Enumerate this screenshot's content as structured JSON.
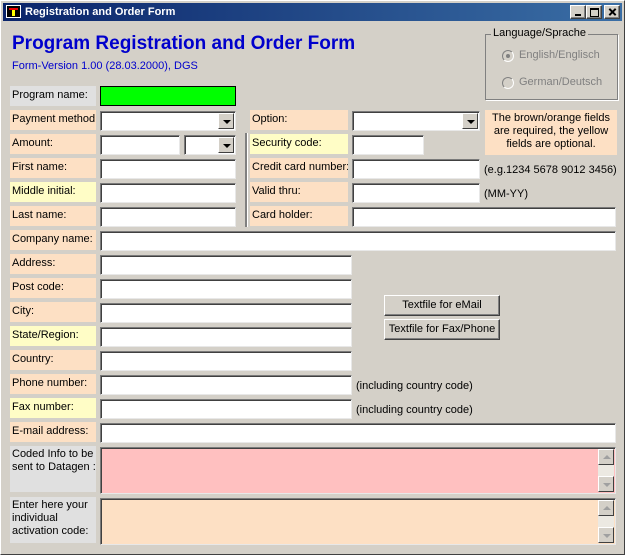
{
  "window": {
    "title": "Registration and Order Form",
    "minimize_icon": "minimize-icon",
    "maximize_icon": "maximize-icon",
    "close_icon": "close-icon"
  },
  "header": {
    "title": "Program Registration and Order Form",
    "version": "Form-Version 1.00 (28.03.2000), DGS"
  },
  "language": {
    "group_label": "Language/Sprache",
    "options": [
      {
        "label": "English/Englisch",
        "selected": true
      },
      {
        "label": "German/Deutsch",
        "selected": false
      }
    ]
  },
  "note": "The brown/orange fields are required, the yellow fields are optional.",
  "labels": {
    "program_name": "Program name:",
    "payment_method": "Payment method:",
    "amount": "Amount:",
    "first_name": "First name:",
    "middle_initial": "Middle initial:",
    "last_name": "Last name:",
    "company_name": "Company name:",
    "address": "Address:",
    "post_code": "Post code:",
    "city": "City:",
    "state_region": "State/Region:",
    "country": "Country:",
    "phone_number": "Phone number:",
    "fax_number": "Fax number:",
    "email_address": "E-mail address:",
    "coded_info": "Coded Info to be sent to Datagen :",
    "activation_code": "Enter here your individual activation code:",
    "option": "Option:",
    "security_code": "Security code:",
    "credit_card_number": "Credit card number:",
    "valid_thru": "Valid thru:",
    "card_holder": "Card holder:"
  },
  "hints": {
    "card_number_example": "(e.g.1234 5678 9012 3456)",
    "valid_thru_format": "(MM-YY)",
    "phone_country_code": "(including country code)",
    "fax_country_code": "(including country code)"
  },
  "buttons": {
    "textfile_email": "Textfile for eMail",
    "textfile_fax": "Textfile for Fax/Phone"
  },
  "colors": {
    "required": "#fde0c4",
    "optional": "#fffdc6",
    "program_field": "#00ff00",
    "coded_info_bg": "#ffc0c0",
    "title": "#0000cc"
  }
}
